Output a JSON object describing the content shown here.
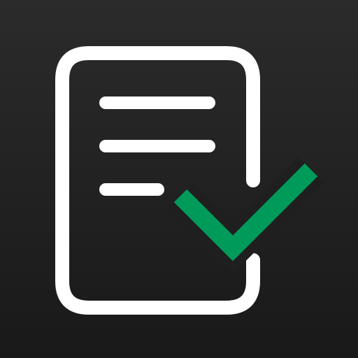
{
  "icon": {
    "name": "document-checklist-icon",
    "colors": {
      "background_top": "#2b2b2b",
      "background_bottom": "#191919",
      "document_stroke": "#ffffff",
      "text_line": "#ffffff",
      "checkmark": "#009a5b"
    }
  }
}
